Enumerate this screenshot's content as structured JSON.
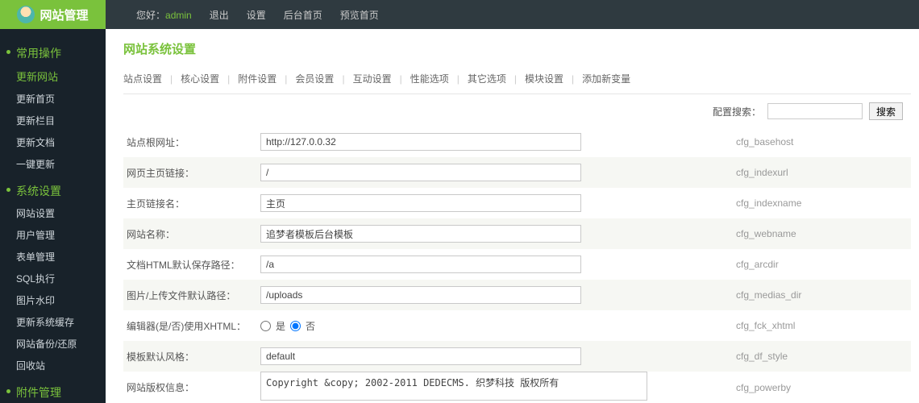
{
  "top": {
    "brand": "网站管理",
    "hello": "您好：",
    "admin": "admin",
    "links": [
      "退出",
      "设置",
      "后台首页",
      "预览首页"
    ]
  },
  "sidebar": {
    "g1": {
      "title": "常用操作",
      "special": "更新网站",
      "items": [
        "更新首页",
        "更新栏目",
        "更新文档",
        "一键更新"
      ]
    },
    "g2": {
      "title": "系统设置",
      "items": [
        "网站设置",
        "用户管理",
        "表单管理",
        "SQL执行",
        "图片水印",
        "更新系统缓存",
        "网站备份/还原",
        "回收站"
      ]
    },
    "g3": {
      "title": "附件管理"
    }
  },
  "page": {
    "title": "网站系统设置",
    "tabs": [
      "站点设置",
      "核心设置",
      "附件设置",
      "会员设置",
      "互动设置",
      "性能选项",
      "其它选项",
      "模块设置",
      "添加新变量"
    ],
    "search_label": "配置搜索：",
    "search_btn": "搜索"
  },
  "rows": [
    {
      "label": "站点根网址：",
      "value": "http://127.0.0.32",
      "key": "cfg_basehost",
      "type": "text"
    },
    {
      "label": "网页主页链接：",
      "value": "/",
      "key": "cfg_indexurl",
      "type": "text"
    },
    {
      "label": "主页链接名：",
      "value": "主页",
      "key": "cfg_indexname",
      "type": "text"
    },
    {
      "label": "网站名称：",
      "value": "追梦者模板后台模板",
      "key": "cfg_webname",
      "type": "text"
    },
    {
      "label": "文档HTML默认保存路径：",
      "value": "/a",
      "key": "cfg_arcdir",
      "type": "text"
    },
    {
      "label": "图片/上传文件默认路径：",
      "value": "/uploads",
      "key": "cfg_medias_dir",
      "type": "text"
    },
    {
      "label": "编辑器(是/否)使用XHTML：",
      "opt_yes": "是",
      "opt_no": "否",
      "key": "cfg_fck_xhtml",
      "type": "radio"
    },
    {
      "label": "模板默认风格：",
      "value": "default",
      "key": "cfg_df_style",
      "type": "text"
    },
    {
      "label": "网站版权信息：",
      "value": "Copyright &copy; 2002-2011 DEDECMS. 织梦科技 版权所有",
      "key": "cfg_powerby",
      "type": "textarea"
    }
  ]
}
